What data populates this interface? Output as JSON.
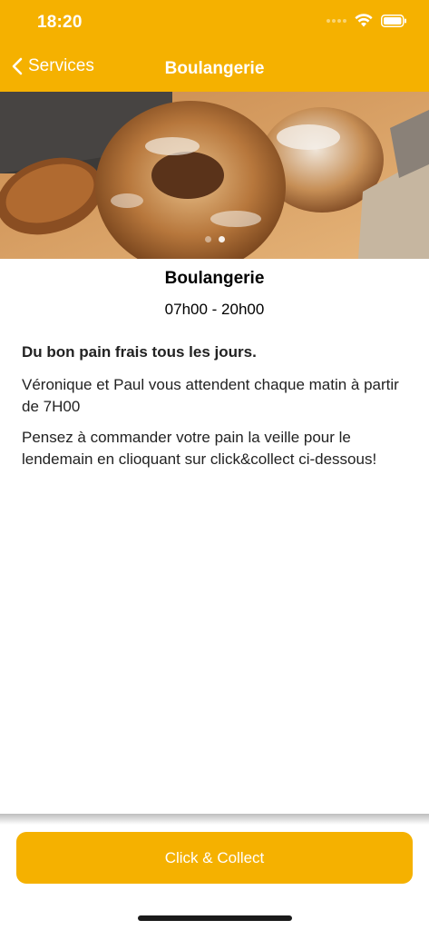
{
  "status_bar": {
    "time": "18:20"
  },
  "nav": {
    "back_label": "Services",
    "title": "Boulangerie"
  },
  "hero": {
    "image_desc": "bread-loaves-photo",
    "page_count": 2,
    "active_page": 2
  },
  "service": {
    "name": "Boulangerie",
    "hours": "07h00 - 20h00",
    "lead": "Du bon pain frais tous les jours.",
    "paragraphs": [
      "Véronique et Paul vous attendent chaque matin à partir de 7H00",
      "Pensez à commander votre pain la veille pour le lendemain en clioquant sur click&collect ci-dessous!"
    ]
  },
  "cta": {
    "label": "Click & Collect"
  },
  "colors": {
    "accent": "#f5b100"
  }
}
